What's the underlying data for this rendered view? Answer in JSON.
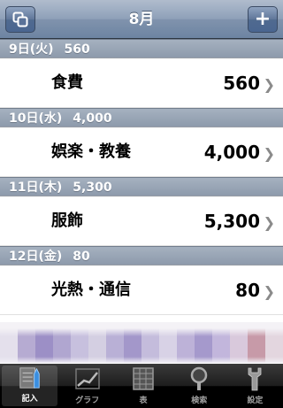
{
  "navbar": {
    "title": "8月",
    "left_button_icon": "copy-icon",
    "right_button_label": "+"
  },
  "sections": [
    {
      "date": "9日(火)",
      "total": "560",
      "row": {
        "category": "食費",
        "amount": "560"
      }
    },
    {
      "date": "10日(水)",
      "total": "4,000",
      "row": {
        "category": "娯楽・教養",
        "amount": "4,000"
      }
    },
    {
      "date": "11日(木)",
      "total": "5,300",
      "row": {
        "category": "服飾",
        "amount": "5,300"
      }
    },
    {
      "date": "12日(金)",
      "total": "80",
      "row": {
        "category": "光熱・通信",
        "amount": "80"
      }
    }
  ],
  "ad_banner": {
    "colors": [
      "#e4e0ec",
      "#b6abd2",
      "#9c8fc6",
      "#b0a6d0",
      "#c7c0de",
      "#d4cfe2",
      "#b9b0d6",
      "#a397ca",
      "#c4bcdc",
      "#d8d2e6",
      "#bdb2d8",
      "#a599cc",
      "#c2b6dc",
      "#d9c9dc",
      "#c79aa8",
      "#e3d6df"
    ]
  },
  "tabbar": {
    "tabs": [
      {
        "label": "記入",
        "icon": "pencil-notebook-icon",
        "active": true
      },
      {
        "label": "グラフ",
        "icon": "graph-icon",
        "active": false
      },
      {
        "label": "表",
        "icon": "table-icon",
        "active": false
      },
      {
        "label": "検索",
        "icon": "magnifier-icon",
        "active": false
      },
      {
        "label": "設定",
        "icon": "wrench-icon",
        "active": false
      }
    ]
  }
}
